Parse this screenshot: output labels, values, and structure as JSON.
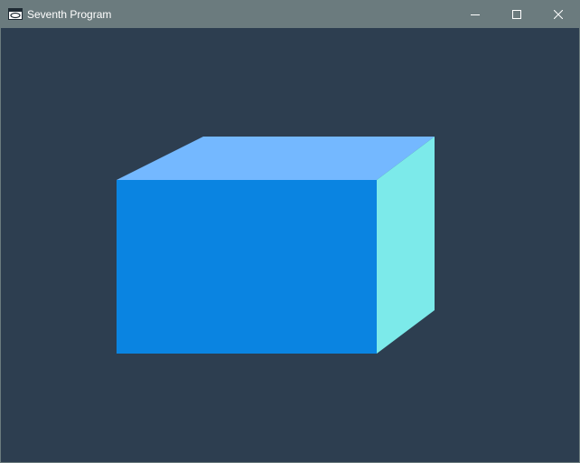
{
  "window": {
    "title": "Seventh Program",
    "icon": "app-window-icon",
    "controls": {
      "minimize_icon": "minimize-icon",
      "maximize_icon": "maximize-icon",
      "close_icon": "close-icon"
    }
  },
  "scene": {
    "background_color": "#2d3e50",
    "object": "box",
    "faces": {
      "front": "#0a84e1",
      "top": "#74b8ff",
      "side": "#7ceaea"
    }
  },
  "colors": {
    "titlebar": "#6b7b7e",
    "title_text": "#ffffff"
  }
}
